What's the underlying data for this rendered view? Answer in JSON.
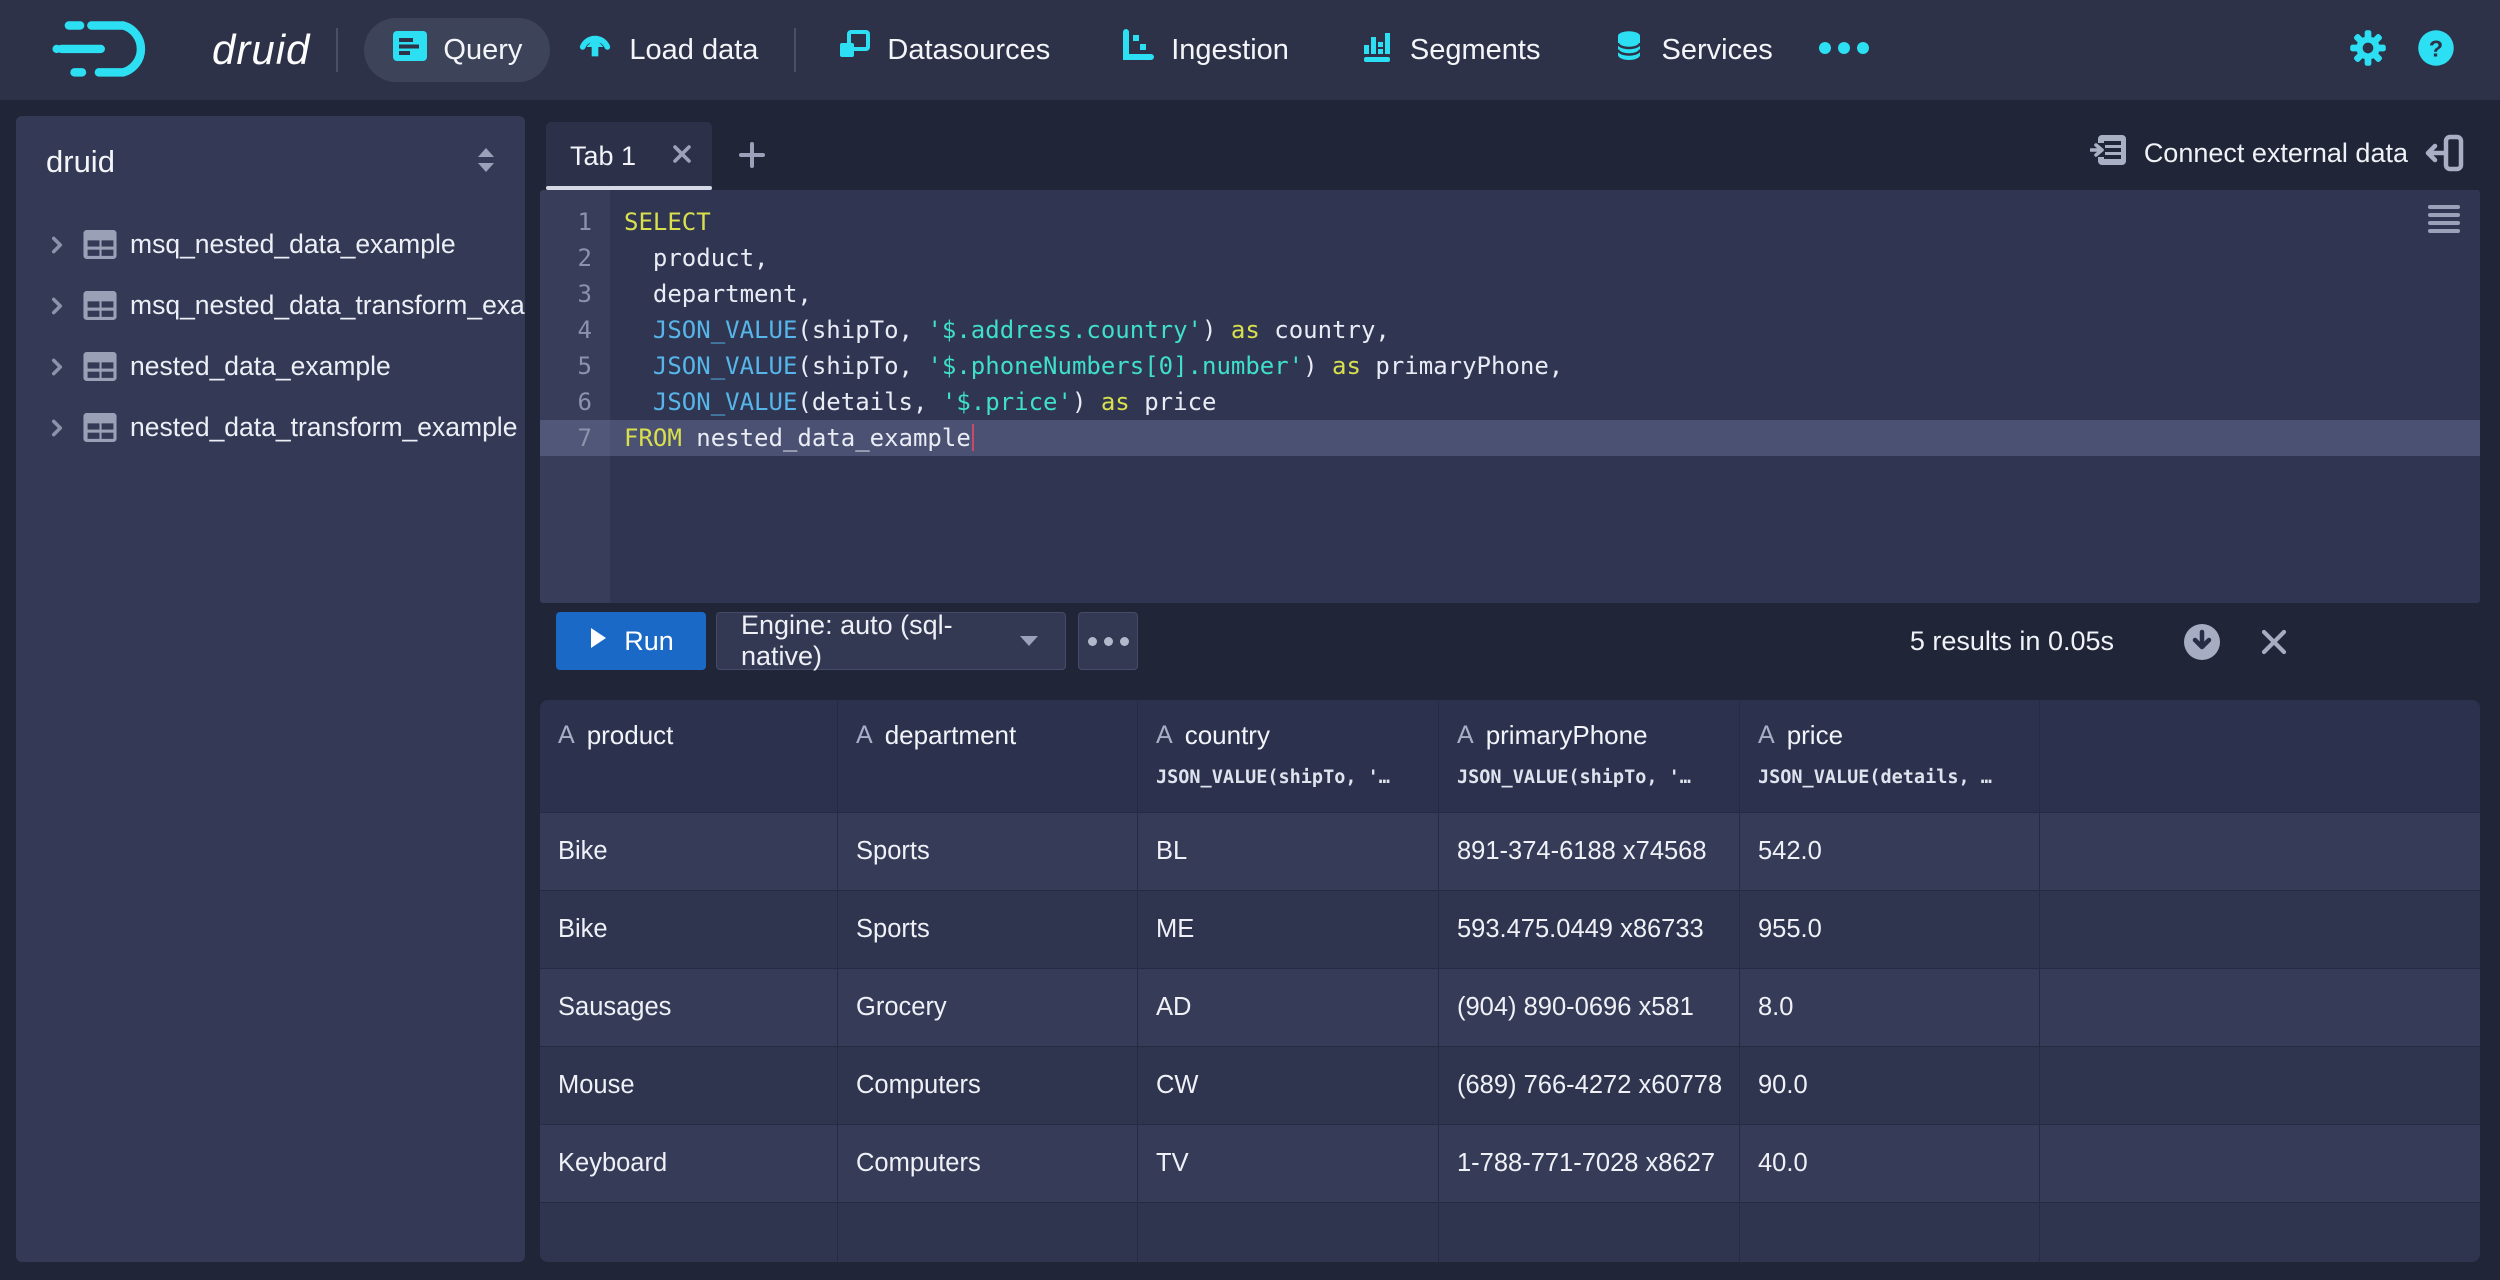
{
  "app": {
    "brand": "druid"
  },
  "colors": {
    "accent": "#2cdff2",
    "run_button": "#1a69c7",
    "sql_keyword": "#d9e04d",
    "sql_function": "#56b6e9",
    "sql_string": "#3fdfc9"
  },
  "icons": {
    "query-icon": "▤",
    "load-data-icon": "⇪",
    "datasources-icon": "❐",
    "ingestion-icon": "⌐",
    "segments-icon": "▮",
    "services-icon": "⛁",
    "more-icon": "•••",
    "gear-icon": "⚙",
    "help-icon": "?",
    "double-caret-vertical-icon": "⇕",
    "chevron-right-icon": "›",
    "table-icon": "▦",
    "close-icon": "×",
    "plus-icon": "+",
    "connect-icon": "⇥",
    "drawer-icon": "⇤",
    "menu-icon": "≡",
    "play-icon": "▶",
    "caret-down-icon": "▾",
    "download-icon": "↓",
    "string-type-icon": "A"
  },
  "navbar": {
    "items": [
      {
        "label": "Query",
        "active": true
      },
      {
        "label": "Load data",
        "active": false
      },
      {
        "label": "Datasources",
        "active": false
      },
      {
        "label": "Ingestion",
        "active": false
      },
      {
        "label": "Segments",
        "active": false
      },
      {
        "label": "Services",
        "active": false
      }
    ]
  },
  "sidebar": {
    "schema": "druid",
    "tables": [
      "msq_nested_data_example",
      "msq_nested_data_transform_example",
      "nested_data_example",
      "nested_data_transform_example"
    ]
  },
  "tabbar": {
    "tabs": [
      {
        "label": "Tab 1",
        "active": true
      }
    ],
    "connect_label": "Connect external data"
  },
  "editor": {
    "lines": [
      {
        "n": "1",
        "toks": [
          [
            "kw",
            "SELECT"
          ]
        ]
      },
      {
        "n": "2",
        "toks": [
          [
            "tx",
            "  product,"
          ]
        ]
      },
      {
        "n": "3",
        "toks": [
          [
            "tx",
            "  department,"
          ]
        ]
      },
      {
        "n": "4",
        "toks": [
          [
            "tx",
            "  "
          ],
          [
            "fn",
            "JSON_VALUE"
          ],
          [
            "tx",
            "(shipTo, "
          ],
          [
            "st",
            "'$.address.country'"
          ],
          [
            "tx",
            ") "
          ],
          [
            "kw",
            "as"
          ],
          [
            "tx",
            " country,"
          ]
        ]
      },
      {
        "n": "5",
        "toks": [
          [
            "tx",
            "  "
          ],
          [
            "fn",
            "JSON_VALUE"
          ],
          [
            "tx",
            "(shipTo, "
          ],
          [
            "st",
            "'$.phoneNumbers[0].number'"
          ],
          [
            "tx",
            ") "
          ],
          [
            "kw",
            "as"
          ],
          [
            "tx",
            " primaryPhone,"
          ]
        ]
      },
      {
        "n": "6",
        "toks": [
          [
            "tx",
            "  "
          ],
          [
            "fn",
            "JSON_VALUE"
          ],
          [
            "tx",
            "(details, "
          ],
          [
            "st",
            "'$.price'"
          ],
          [
            "tx",
            ") "
          ],
          [
            "kw",
            "as"
          ],
          [
            "tx",
            " price"
          ]
        ]
      },
      {
        "n": "7",
        "active": true,
        "cursor": true,
        "toks": [
          [
            "kw",
            "FROM"
          ],
          [
            "tx",
            " nested_data_example"
          ]
        ]
      }
    ]
  },
  "runbar": {
    "run_label": "Run",
    "engine_label": "Engine: auto (sql-native)",
    "results_status": "5 results in 0.05s"
  },
  "results": {
    "columns": [
      {
        "name": "product",
        "expr": ""
      },
      {
        "name": "department",
        "expr": ""
      },
      {
        "name": "country",
        "expr": "JSON_VALUE(shipTo, '…"
      },
      {
        "name": "primaryPhone",
        "expr": "JSON_VALUE(shipTo, '…"
      },
      {
        "name": "price",
        "expr": "JSON_VALUE(details, …"
      }
    ],
    "rows": [
      [
        "Bike",
        "Sports",
        "BL",
        "891-374-6188 x74568",
        "542.0"
      ],
      [
        "Bike",
        "Sports",
        "ME",
        "593.475.0449 x86733",
        "955.0"
      ],
      [
        "Sausages",
        "Grocery",
        "AD",
        "(904) 890-0696 x581",
        "8.0"
      ],
      [
        "Mouse",
        "Computers",
        "CW",
        "(689) 766-4272 x60778",
        "90.0"
      ],
      [
        "Keyboard",
        "Computers",
        "TV",
        "1-788-771-7028 x8627",
        "40.0"
      ]
    ]
  }
}
